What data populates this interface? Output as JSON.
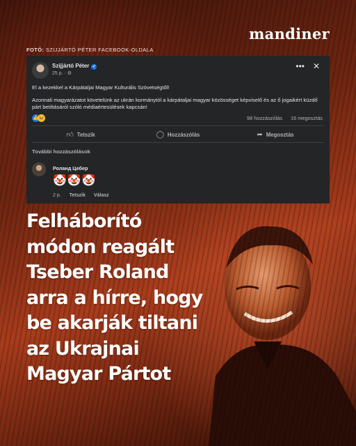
{
  "brand": "mandiner",
  "credit": {
    "label": "FOTÓ:",
    "text": "SZIJJÁRTÓ PÉTER FACEBOOK-OLDALA"
  },
  "post": {
    "author": "Szijjártó Péter",
    "time": "25 p. · ",
    "paragraph1": "El a kezekkel a Kárpátaljai Magyar Kulturális Szövetségtől!",
    "paragraph2": "Azonnali magyarázatot követelünk az ukrán kormánytól a kárpátaljai magyar közösséget képviselő és az ő jogaikért küzdő párt betiltásáról szóló médiaértesülések kapcsán!",
    "comments_count": "98 hozzászólás",
    "shares_count": "16 megosztás",
    "actions": {
      "like": "Tetszik",
      "comment": "Hozzászólás",
      "share": "Megosztás"
    },
    "more_comments": "További hozzászólások",
    "comment": {
      "author": "Роланд Цебер",
      "emojis": "🤡🤡🤡",
      "time": "2 p.",
      "like": "Tetszik",
      "reply": "Válasz"
    }
  },
  "headline": [
    "Felháborító",
    "módon reagált",
    "Tseber Roland",
    "arra a hírre, hogy",
    "be akarják tiltani",
    "az Ukrajnai",
    "Magyar Pártot"
  ],
  "colors": {
    "card_bg": "#242526",
    "card_text": "#e4e6eb",
    "muted_text": "#b0b3b8",
    "fb_blue": "#1b74e4",
    "background_accent": "#a83c1c"
  }
}
